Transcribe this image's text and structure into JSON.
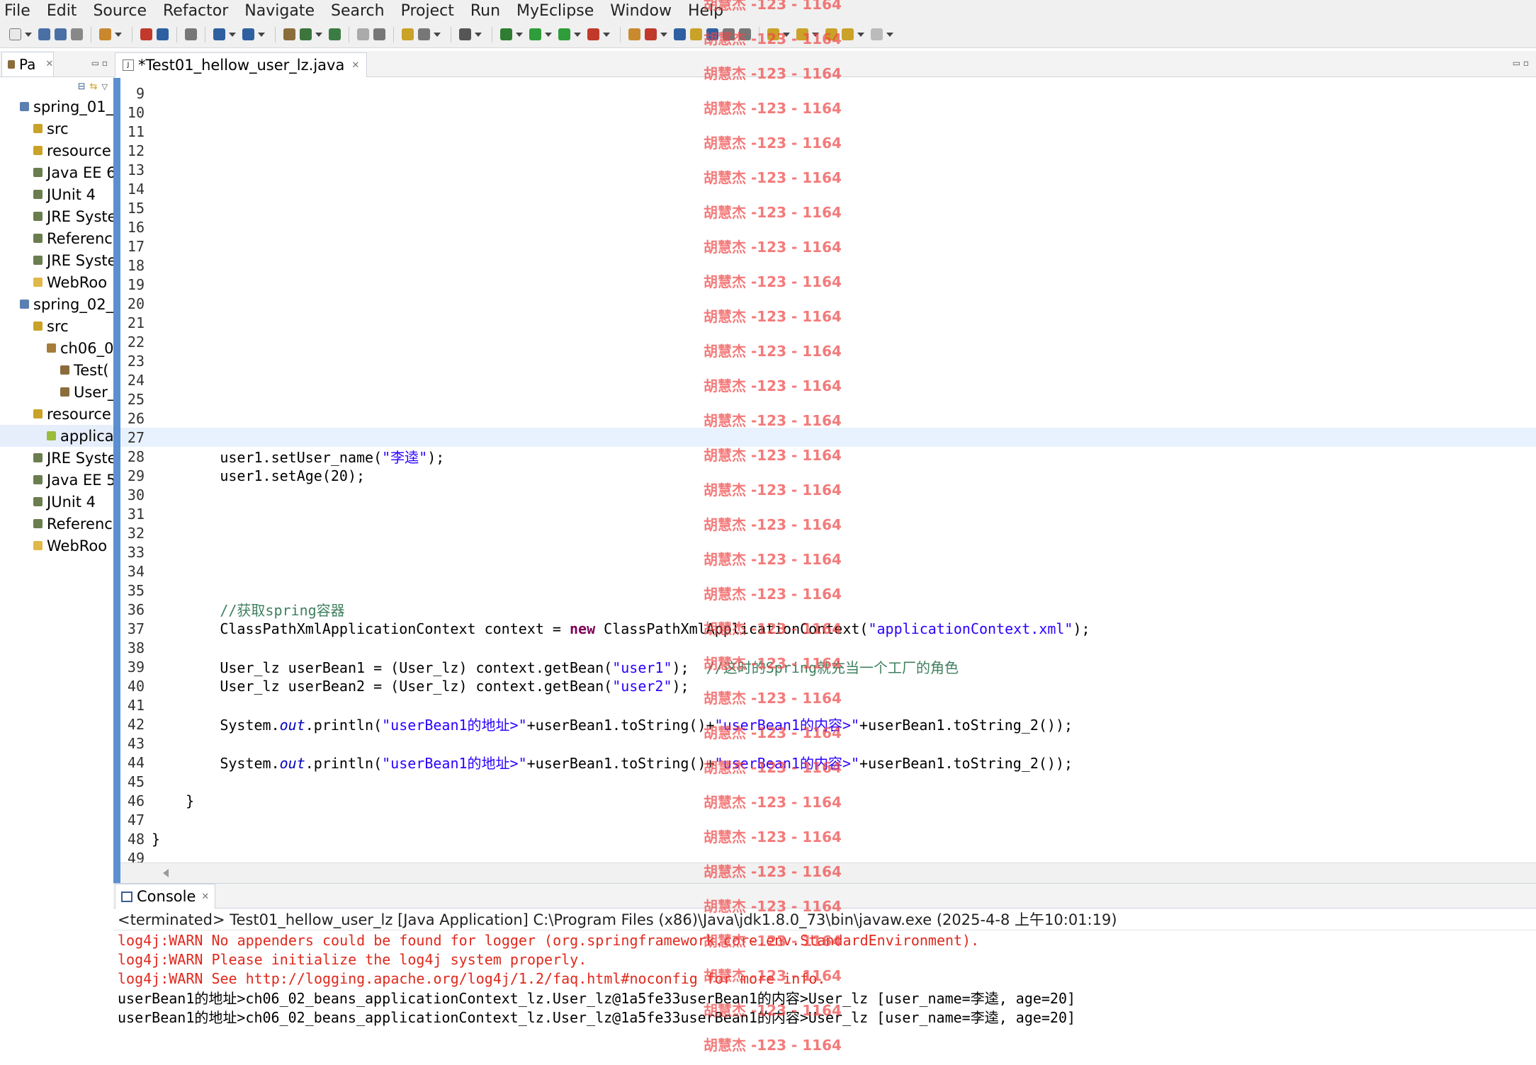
{
  "menu": [
    "File",
    "Edit",
    "Source",
    "Refactor",
    "Navigate",
    "Search",
    "Project",
    "Run",
    "MyEclipse",
    "Window",
    "Help"
  ],
  "package_explorer": {
    "tab_label": "Pa",
    "items": [
      {
        "label": "spring_01_",
        "icon": "project-icon",
        "indent": 0
      },
      {
        "label": "src",
        "icon": "src-folder-icon",
        "indent": 1
      },
      {
        "label": "resource",
        "icon": "src-folder-icon",
        "indent": 1
      },
      {
        "label": "Java EE 6",
        "icon": "library-icon",
        "indent": 1
      },
      {
        "label": "JUnit 4",
        "icon": "library-icon",
        "indent": 1
      },
      {
        "label": "JRE Syste",
        "icon": "library-icon",
        "indent": 1
      },
      {
        "label": "Referenc",
        "icon": "library-icon",
        "indent": 1
      },
      {
        "label": "JRE Syste",
        "icon": "library-icon",
        "indent": 1
      },
      {
        "label": "WebRoo",
        "icon": "folder-icon",
        "indent": 1
      },
      {
        "label": "spring_02_",
        "icon": "project-icon",
        "indent": 0
      },
      {
        "label": "src",
        "icon": "src-folder-icon",
        "indent": 1
      },
      {
        "label": "ch06_0",
        "icon": "package-icon",
        "indent": 2
      },
      {
        "label": "Test(",
        "icon": "java-file-icon",
        "indent": 3
      },
      {
        "label": "User_",
        "icon": "java-file-icon",
        "indent": 3
      },
      {
        "label": "resource",
        "icon": "src-folder-icon",
        "indent": 1
      },
      {
        "label": "applica",
        "icon": "xml-file-icon",
        "indent": 2
      },
      {
        "label": "JRE Syste",
        "icon": "library-icon",
        "indent": 1
      },
      {
        "label": "Java EE 5",
        "icon": "library-icon",
        "indent": 1
      },
      {
        "label": "JUnit 4",
        "icon": "library-icon",
        "indent": 1
      },
      {
        "label": "Referenc",
        "icon": "library-icon",
        "indent": 1
      },
      {
        "label": "WebRoo",
        "icon": "folder-icon",
        "indent": 1
      }
    ],
    "selected_index": 15
  },
  "editor": {
    "tab_label": "*Test01_hellow_user_lz.java",
    "current_line": "27",
    "lines": [
      {
        "n": "9",
        "code": []
      },
      {
        "n": "10",
        "code": []
      },
      {
        "n": "11",
        "code": []
      },
      {
        "n": "12",
        "code": []
      },
      {
        "n": "13",
        "code": []
      },
      {
        "n": "14",
        "code": []
      },
      {
        "n": "15",
        "code": []
      },
      {
        "n": "16",
        "code": []
      },
      {
        "n": "17",
        "code": []
      },
      {
        "n": "18",
        "code": []
      },
      {
        "n": "19",
        "code": []
      },
      {
        "n": "20",
        "code": []
      },
      {
        "n": "21",
        "code": []
      },
      {
        "n": "22",
        "code": []
      },
      {
        "n": "23",
        "code": []
      },
      {
        "n": "24",
        "code": []
      },
      {
        "n": "25",
        "code": []
      },
      {
        "n": "26",
        "code": []
      },
      {
        "n": "27",
        "code": []
      },
      {
        "n": "28",
        "code": [
          {
            "t": "        user1.setUser_name("
          },
          {
            "t": "\"李逵\"",
            "c": "str"
          },
          {
            "t": ");"
          }
        ]
      },
      {
        "n": "29",
        "code": [
          {
            "t": "        user1.setAge(20);"
          }
        ]
      },
      {
        "n": "30",
        "code": []
      },
      {
        "n": "31",
        "code": []
      },
      {
        "n": "32",
        "code": []
      },
      {
        "n": "33",
        "code": []
      },
      {
        "n": "34",
        "code": []
      },
      {
        "n": "35",
        "code": []
      },
      {
        "n": "36",
        "code": [
          {
            "t": "        "
          },
          {
            "t": "//获取spring容器",
            "c": "cmt"
          }
        ]
      },
      {
        "n": "37",
        "code": [
          {
            "t": "        ClassPathXmlApplicationContext context = "
          },
          {
            "t": "new",
            "c": "kw"
          },
          {
            "t": " ClassPathXmlApplicationContext("
          },
          {
            "t": "\"applicationContext.xml\"",
            "c": "str"
          },
          {
            "t": ");"
          }
        ]
      },
      {
        "n": "38",
        "code": []
      },
      {
        "n": "39",
        "code": [
          {
            "t": "        User_lz userBean1 = (User_lz) context.getBean("
          },
          {
            "t": "\"user1\"",
            "c": "str"
          },
          {
            "t": ");  "
          },
          {
            "t": "//这时的Spring就充当一个工厂的角色",
            "c": "cmt"
          }
        ]
      },
      {
        "n": "40",
        "code": [
          {
            "t": "        User_lz userBean2 = (User_lz) context.getBean("
          },
          {
            "t": "\"user2\"",
            "c": "str"
          },
          {
            "t": ");"
          }
        ]
      },
      {
        "n": "41",
        "code": []
      },
      {
        "n": "42",
        "code": [
          {
            "t": "        System."
          },
          {
            "t": "out",
            "c": "fld"
          },
          {
            "t": ".println("
          },
          {
            "t": "\"userBean1的地址>\"",
            "c": "str"
          },
          {
            "t": "+userBean1.toString()+"
          },
          {
            "t": "\"userBean1的内容>\"",
            "c": "str"
          },
          {
            "t": "+userBean1.toString_2());"
          }
        ]
      },
      {
        "n": "43",
        "code": []
      },
      {
        "n": "44",
        "code": [
          {
            "t": "        System."
          },
          {
            "t": "out",
            "c": "fld"
          },
          {
            "t": ".println("
          },
          {
            "t": "\"userBean1的地址>\"",
            "c": "str"
          },
          {
            "t": "+userBean1.toString()+"
          },
          {
            "t": "\"userBean1的内容>\"",
            "c": "str"
          },
          {
            "t": "+userBean1.toString_2());"
          }
        ]
      },
      {
        "n": "45",
        "code": []
      },
      {
        "n": "46",
        "code": [
          {
            "t": "    }"
          }
        ]
      },
      {
        "n": "47",
        "code": []
      },
      {
        "n": "48",
        "code": [
          {
            "t": "}"
          }
        ]
      },
      {
        "n": "49",
        "code": []
      }
    ]
  },
  "console": {
    "tab_label": "Console",
    "status": "<terminated> Test01_hellow_user_lz [Java Application] C:\\Program Files (x86)\\Java\\jdk1.8.0_73\\bin\\javaw.exe (2025-4-8 上午10:01:19)",
    "lines": [
      {
        "text": "log4j:WARN No appenders could be found for logger (org.springframework.core.env.StandardEnvironment).",
        "kind": "err"
      },
      {
        "text": "log4j:WARN Please initialize the log4j system properly.",
        "kind": "err"
      },
      {
        "text": "log4j:WARN See http://logging.apache.org/log4j/1.2/faq.html#noconfig for more info.",
        "kind": "err"
      },
      {
        "text": "userBean1的地址>ch06_02_beans_applicationContext_lz.User_lz@1a5fe33userBean1的内容>User_lz [user_name=李逵, age=20]",
        "kind": "out"
      },
      {
        "text": "userBean1的地址>ch06_02_beans_applicationContext_lz.User_lz@1a5fe33userBean1的内容>User_lz [user_name=李逵, age=20]",
        "kind": "out"
      }
    ]
  },
  "watermark": {
    "text": "胡慧杰 -123 - 1164",
    "count": 31
  },
  "colors": {
    "keyword": "#7f0055",
    "string": "#2a00ff",
    "comment": "#3f7f5f",
    "error": "#e0281c",
    "watermark": "#f04646"
  }
}
